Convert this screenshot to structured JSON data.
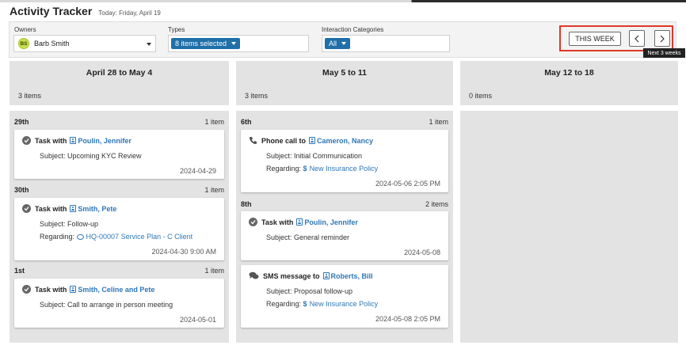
{
  "header": {
    "title": "Activity Tracker",
    "today": "Today: Friday, April 19"
  },
  "filters": {
    "owners_label": "Owners",
    "owner_initials": "BS",
    "owner_name": "Barb Smith",
    "types_label": "Types",
    "types_value": "8 items selected",
    "categories_label": "Interaction Categories",
    "categories_value": "All"
  },
  "nav": {
    "this_week": "THIS WEEK",
    "tooltip": "Next 3 weeks"
  },
  "columns": [
    {
      "range": "April 28 to May 4",
      "count": "3 items",
      "days": [
        {
          "day": "29th",
          "count": "1 item",
          "cards": [
            {
              "title": "Task with",
              "contact": "Poulin, Jennifer",
              "subject": "Subject: Upcoming KYC Review",
              "date": "2024-04-29"
            }
          ]
        },
        {
          "day": "30th",
          "count": "1 item",
          "cards": [
            {
              "title": "Task with",
              "contact": "Smith, Pete",
              "subject": "Subject: Follow-up",
              "regarding_label": "Regarding:",
              "regarding": "HQ-00007 Service Plan - C Client",
              "date": "2024-04-30 9:00 AM"
            }
          ]
        },
        {
          "day": "1st",
          "count": "1 item",
          "cards": [
            {
              "title": "Task with",
              "contact": "Smith, Celine and Pete",
              "subject": "Subject: Call to arrange in person meeting",
              "date": "2024-05-01"
            }
          ]
        }
      ]
    },
    {
      "range": "May 5 to 11",
      "count": "3 items",
      "days": [
        {
          "day": "6th",
          "count": "1 item",
          "cards": [
            {
              "title": "Phone call to",
              "contact": "Cameron, Nancy",
              "subject": "Subject: Initial Communication",
              "regarding_label": "Regarding:",
              "regarding": "New Insurance Policy",
              "date": "2024-05-06 2:05 PM"
            }
          ]
        },
        {
          "day": "8th",
          "count": "2 items",
          "cards": [
            {
              "title": "Task with",
              "contact": "Poulin, Jennifer",
              "subject": "Subject: General reminder",
              "date": "2024-05-08"
            },
            {
              "title": "SMS message to",
              "contact": "Roberts, Bill",
              "subject": "Subject: Proposal follow-up",
              "regarding_label": "Regarding:",
              "regarding": "New Insurance Policy",
              "date": "2024-05-08 2:05 PM"
            }
          ]
        }
      ]
    },
    {
      "range": "May 12 to 18",
      "count": "0 items",
      "days": []
    }
  ]
}
